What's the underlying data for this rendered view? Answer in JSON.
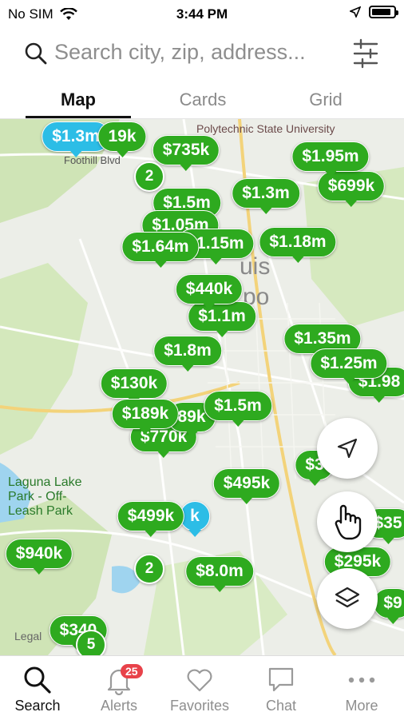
{
  "status": {
    "carrier": "No SIM",
    "time": "3:44 PM"
  },
  "search": {
    "placeholder": "Search city, zip, address..."
  },
  "tabs": [
    {
      "label": "Map",
      "active": true
    },
    {
      "label": "Cards",
      "active": false
    },
    {
      "label": "Grid",
      "active": false
    }
  ],
  "map": {
    "labels": {
      "university": "Polytechnic State University",
      "road": "Foothill Blvd",
      "park": "Laguna Lake Park - Off-Leash Park",
      "city_partial": "uis",
      "city_partial2": "po",
      "legal": "Legal"
    },
    "pins": [
      {
        "label": "$1.3m",
        "color": "blue"
      },
      {
        "label": "19k",
        "color": "green"
      },
      {
        "label": "$735k",
        "color": "green"
      },
      {
        "label": "$1.95m",
        "color": "green"
      },
      {
        "label": "$699k",
        "color": "green"
      },
      {
        "label": "$1.3m",
        "color": "green"
      },
      {
        "label": "$1.5m",
        "color": "green"
      },
      {
        "label": "$1.05m",
        "color": "green"
      },
      {
        "label": "$1.64m",
        "color": "green"
      },
      {
        "label": "$1.15m",
        "color": "green"
      },
      {
        "label": "$1.18m",
        "color": "green"
      },
      {
        "label": "$440k",
        "color": "green"
      },
      {
        "label": "$1.1m",
        "color": "green"
      },
      {
        "label": "$1.8m",
        "color": "green"
      },
      {
        "label": "$1.35m",
        "color": "green"
      },
      {
        "label": "$1.25m",
        "color": "green"
      },
      {
        "label": "$1.98",
        "color": "green"
      },
      {
        "label": "$130k",
        "color": "green"
      },
      {
        "label": "$189k",
        "color": "green"
      },
      {
        "label": "89k",
        "color": "green"
      },
      {
        "label": "$1.5m",
        "color": "green"
      },
      {
        "label": "$770k",
        "color": "green"
      },
      {
        "label": "$3",
        "color": "green"
      },
      {
        "label": "$495k",
        "color": "green"
      },
      {
        "label": "$499k",
        "color": "green"
      },
      {
        "label": "k",
        "color": "green"
      },
      {
        "label": "$35",
        "color": "green"
      },
      {
        "label": "$940k",
        "color": "green"
      },
      {
        "label": "$295k",
        "color": "green"
      },
      {
        "label": "$8.0m",
        "color": "green"
      },
      {
        "label": "$9",
        "color": "green"
      },
      {
        "label": "$340",
        "color": "green"
      }
    ],
    "clusters": [
      {
        "label": "2"
      },
      {
        "label": "2"
      },
      {
        "label": "5"
      }
    ]
  },
  "bottom_nav": [
    {
      "label": "Search",
      "icon": "search-icon",
      "active": true
    },
    {
      "label": "Alerts",
      "icon": "bell-icon",
      "badge": "25"
    },
    {
      "label": "Favorites",
      "icon": "heart-icon"
    },
    {
      "label": "Chat",
      "icon": "chat-icon"
    },
    {
      "label": "More",
      "icon": "more-icon"
    }
  ]
}
